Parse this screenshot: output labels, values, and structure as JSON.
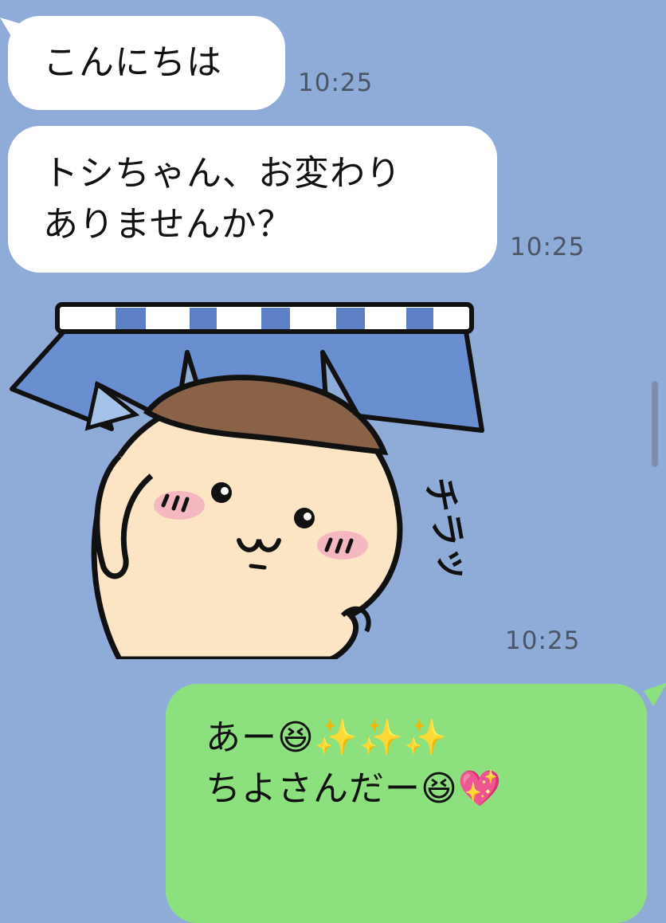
{
  "messages": [
    {
      "text": "こんにちは",
      "time": "10:25"
    },
    {
      "line1": "トシちゃん、お変わり",
      "line2": "ありませんか？",
      "time": "10:25"
    },
    {
      "sticker_text": "チラッ",
      "time": "10:25"
    },
    {
      "line1": "あー😆✨✨✨",
      "line2": "ちよさんだー😆💖"
    }
  ],
  "colors": {
    "background": "#8fabd8",
    "incoming_bubble": "#ffffff",
    "outgoing_bubble": "#8de07e"
  },
  "icons": {
    "sticker": "shy-hamster-under-curtain-sticker",
    "scrollbar": "vertical-scrollbar"
  }
}
